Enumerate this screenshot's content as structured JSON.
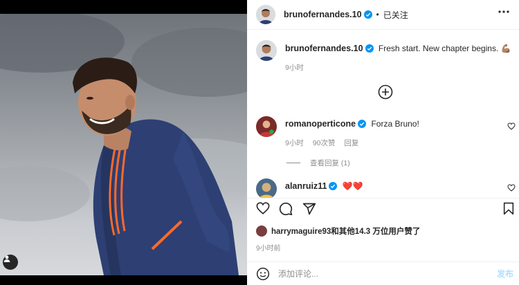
{
  "header": {
    "username": "brunofernandes.10",
    "follow_status": "已关注",
    "separator": "•"
  },
  "caption": {
    "username": "brunofernandes.10",
    "text": "Fresh start. New chapter begins. 💪🏽",
    "time": "9小时"
  },
  "comments": [
    {
      "username": "romanoperticone",
      "text": "Forza Bruno!",
      "time": "9小时",
      "likes": "90次赞",
      "reply_label": "回复",
      "view_replies": "查看回复 (1)"
    },
    {
      "username": "alanruiz11",
      "text": "❤️❤️"
    }
  ],
  "likes_summary": "harrymaguire93和其他14.3 万位用户赞了",
  "post_time": "9小时前",
  "composer": {
    "placeholder": "添加评论...",
    "post_label": "发布"
  },
  "colors": {
    "verified": "#0095f6",
    "heart": "#ed4956",
    "post_disabled": "#b2dffc"
  }
}
